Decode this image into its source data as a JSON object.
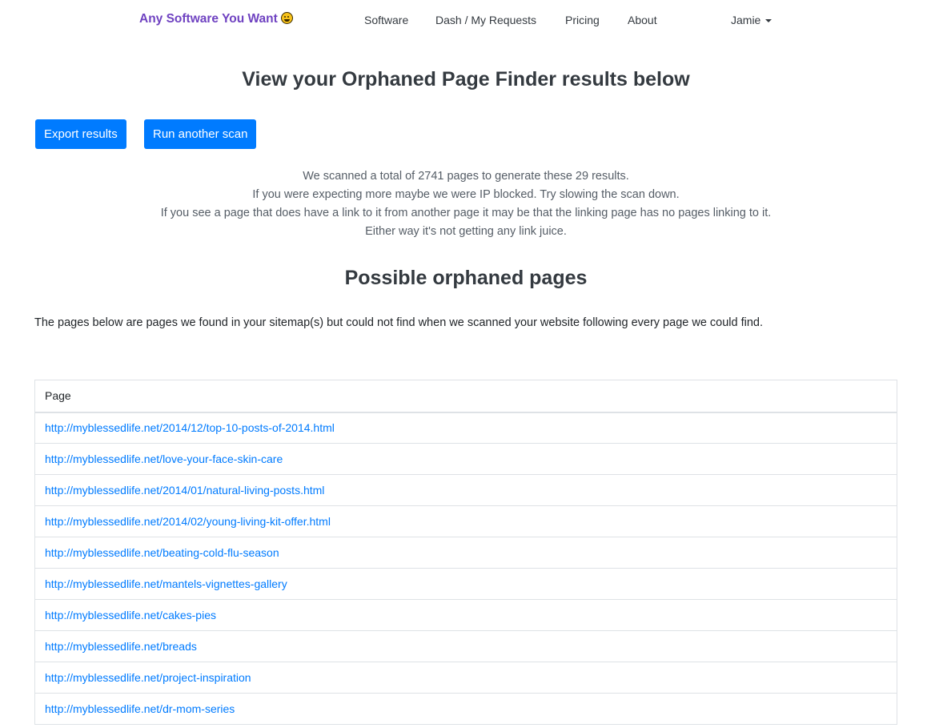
{
  "navbar": {
    "brand": "Any Software You Want",
    "brand_icon": "smiley-face-icon",
    "links": [
      {
        "label": "Software"
      },
      {
        "label": "Dash / My Requests"
      },
      {
        "label": "Pricing"
      },
      {
        "label": "About"
      }
    ],
    "user": "Jamie"
  },
  "page_title": "View your Orphaned Page Finder results below",
  "actions": {
    "export_label": "Export results",
    "rescan_label": "Run another scan"
  },
  "info": {
    "line1": "We scanned a total of 2741 pages to generate these 29 results.",
    "line2": "If you were expecting more maybe we were IP blocked. Try slowing the scan down.",
    "line3": "If you see a page that does have a link to it from another page it may be that the linking page has no pages linking to it. Either way it's not getting any link juice."
  },
  "section_title": "Possible orphaned pages",
  "description": "The pages below are pages we found in your sitemap(s) but could not find when we scanned your website following every page we could find.",
  "table": {
    "header": "Page",
    "rows": [
      "http://myblessedlife.net/2014/12/top-10-posts-of-2014.html",
      "http://myblessedlife.net/love-your-face-skin-care",
      "http://myblessedlife.net/2014/01/natural-living-posts.html",
      "http://myblessedlife.net/2014/02/young-living-kit-offer.html",
      "http://myblessedlife.net/beating-cold-flu-season",
      "http://myblessedlife.net/mantels-vignettes-gallery",
      "http://myblessedlife.net/cakes-pies",
      "http://myblessedlife.net/breads",
      "http://myblessedlife.net/project-inspiration",
      "http://myblessedlife.net/dr-mom-series"
    ]
  },
  "colors": {
    "brand": "#6f42c1",
    "primary": "#007bff",
    "link": "#007bff",
    "muted_text": "#555d66"
  }
}
